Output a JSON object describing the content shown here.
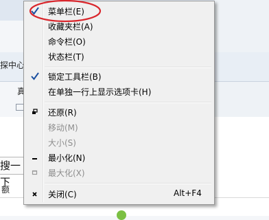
{
  "background": {
    "tab_text": "探中心",
    "zhen_text": "真",
    "search_text": "搜一下",
    "e_text": "额"
  },
  "menu": {
    "items": [
      {
        "label": "菜单栏(E)",
        "checked": true,
        "enabled": true
      },
      {
        "label": "收藏夹栏(A)",
        "enabled": true
      },
      {
        "label": "命令栏(O)",
        "enabled": true
      },
      {
        "label": "状态栏(T)",
        "enabled": true
      },
      {
        "label": "锁定工具栏(B)",
        "checked": true,
        "enabled": true
      },
      {
        "label": "在单独一行上显示选项卡(H)",
        "enabled": true
      },
      {
        "label": "还原(R)",
        "icon": "restore-icon",
        "enabled": true
      },
      {
        "label": "移动(M)",
        "enabled": false
      },
      {
        "label": "大小(S)",
        "enabled": false
      },
      {
        "label": "最小化(N)",
        "icon": "minimize-icon",
        "enabled": true
      },
      {
        "label": "最大化(X)",
        "icon": "maximize-icon",
        "enabled": false
      },
      {
        "label": "关闭(C)",
        "icon": "close-icon",
        "shortcut": "Alt+F4",
        "enabled": true
      }
    ]
  },
  "colors": {
    "annotation_circle": "#d9262c",
    "check": "#1a4fa0",
    "disabled_text": "#8d8d8d"
  }
}
